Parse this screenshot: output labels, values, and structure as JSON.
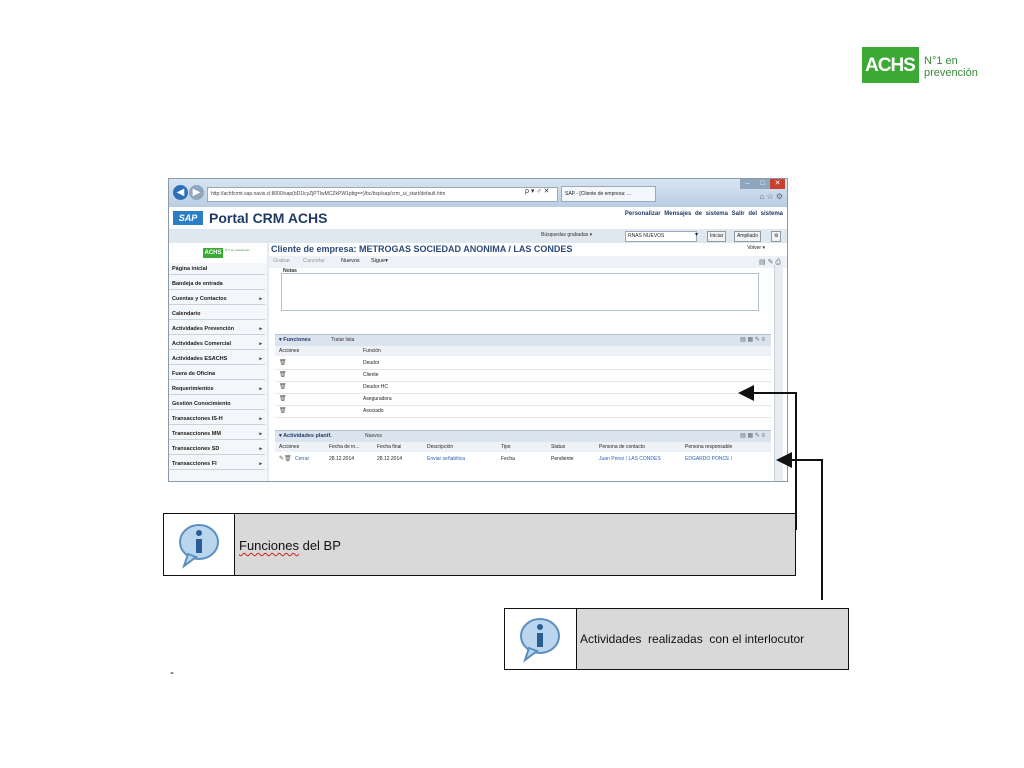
{
  "brand": {
    "logo_text": "ACHS",
    "tagline_1": "N°1 en",
    "tagline_2": "prevención",
    "green": "#3aaa35"
  },
  "browser": {
    "address": "http://achfcrmt.sap.navis.cl:8000/sap(bD1lcyZjPTIwMCZkPW1pbg==)/bc/bsp/sap/crm_ui_start/default.htm",
    "address_controls": "ρ ▾ ♂ ✕",
    "tab_title": "SAP - [Cliente de empresa: ...",
    "toolbar_icons": "⌂ ☆ ⚙"
  },
  "sap": {
    "logo": "SAP",
    "title": "Portal CRM ACHS",
    "links": "Personalizar  Mensajes de sistema  Salir del sistema",
    "saved_search_label": "Búsquedas grabadas ▾",
    "saved_search_value": "RNAS NUEVOS",
    "start_button": "Iniciar",
    "expand_button": "Ampliado"
  },
  "sidebar": {
    "logo": "ACHS",
    "logo_tag": "N°1 en prevención",
    "items": [
      {
        "label": "Página inicial",
        "arrow": ""
      },
      {
        "label": "Bandeja de entrada",
        "arrow": ""
      },
      {
        "label": "Cuentas y Contactos",
        "arrow": "▸"
      },
      {
        "label": "Calendario",
        "arrow": ""
      },
      {
        "label": "Actividades Prevención",
        "arrow": "▸"
      },
      {
        "label": "Actividades Comercial",
        "arrow": "▸"
      },
      {
        "label": "Actividades ESACHS",
        "arrow": "▸"
      },
      {
        "label": "Fuera de Oficina",
        "arrow": ""
      },
      {
        "label": "Requerimientos",
        "arrow": "▸"
      },
      {
        "label": "Gestión Conocimiento",
        "arrow": ""
      },
      {
        "label": "Transacciones IS-H",
        "arrow": "▸"
      },
      {
        "label": "Transacciones MM",
        "arrow": "▸"
      },
      {
        "label": "Transacciones SD",
        "arrow": "▸"
      },
      {
        "label": "Transacciones FI",
        "arrow": "▸"
      }
    ]
  },
  "main": {
    "page_title": "Cliente de empresa: METROGAS SOCIEDAD ANONIMA / LAS CONDES",
    "volver": "Volver ▾",
    "toolbar": {
      "grabar": "Grabar",
      "cancelar": "Cancelar",
      "nuevos": "Nuevos",
      "sigue": "Sigue▾",
      "right_icons": "▤ ✎ ⎙"
    },
    "notes_label": "Notas",
    "funciones": {
      "title": "▾ Funciones",
      "action": "Tratar lista",
      "icons": "▤ ▦ ✎ ≡",
      "columns": [
        "Acciones",
        "Función"
      ],
      "rows": [
        {
          "action_icon": "🗑",
          "funcion": "Deudor"
        },
        {
          "action_icon": "🗑",
          "funcion": "Cliente"
        },
        {
          "action_icon": "🗑",
          "funcion": "Deudor HC"
        },
        {
          "action_icon": "🗑",
          "funcion": "Aseguradora"
        },
        {
          "action_icon": "🗑",
          "funcion": "Asociado"
        }
      ]
    },
    "actividades": {
      "title": "▾ Actividades planif.",
      "action": "Nuevos",
      "icons": "▤ ▦ ✎ ≡",
      "columns": [
        "Acciones",
        "Fecha de in...",
        "Fecha final",
        "Descripción",
        "Tipo",
        "Status",
        "Persona de contacto",
        "Persona responsable"
      ],
      "rows": [
        {
          "acciones": "Cerrar",
          "fecha_inicio": "28.12.2014",
          "fecha_final": "28.12.2014",
          "descripcion": "Enviar señalética",
          "tipo": "Fecha",
          "status": "Pendiente",
          "contacto": "Juan Perez / LAS CONDES",
          "responsable": "EDGARDO PONCE /"
        }
      ]
    }
  },
  "callouts": {
    "funciones": "Funciones del BP",
    "funciones_word": "Funciones",
    "funciones_rest": " del BP",
    "actividades": "Actividades  realizadas  con el interlocutor",
    "dash": "-"
  }
}
